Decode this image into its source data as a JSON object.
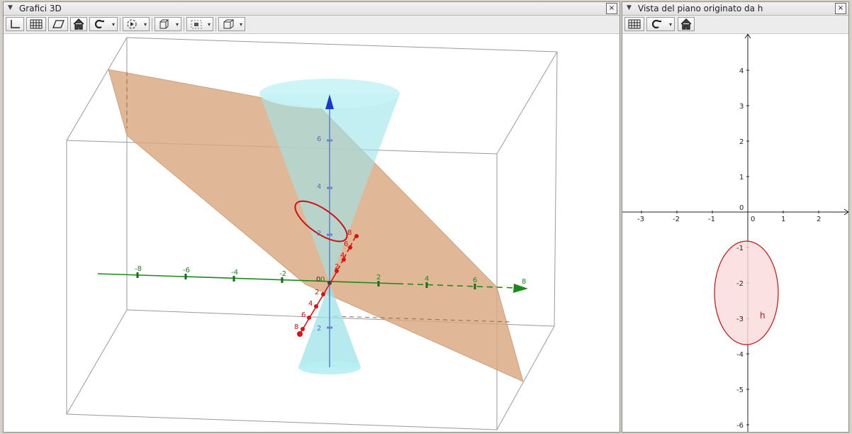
{
  "left_panel": {
    "title": "Grafici 3D",
    "close_glyph": "×",
    "toolbar": [
      "axes-icon",
      "grid-icon",
      "plane-icon",
      "home-icon",
      "rotate-view-icon",
      "animate-icon",
      "view-direction-icon",
      "projection-icon",
      "box-icon"
    ],
    "dropdown_caret": "▾",
    "x_axis_labels": [
      "-8",
      "-6",
      "-4",
      "-2",
      "0",
      "2",
      "4",
      "6",
      "8"
    ],
    "y_axis_labels": [
      "8",
      "6",
      "4",
      "2",
      "2",
      "4",
      "6",
      "8"
    ],
    "z_axis_labels": [
      "6",
      "4",
      "2",
      "2"
    ],
    "origin_label": "0"
  },
  "right_panel": {
    "title": "Vista del piano originato da h",
    "close_glyph": "×",
    "toolbar": [
      "grid-icon",
      "rotate-icon",
      "home-icon"
    ],
    "x_ticks": [
      "-3",
      "-2",
      "-1",
      "0",
      "1",
      "2"
    ],
    "y_ticks": [
      "4",
      "3",
      "2",
      "1",
      "0",
      "-1",
      "-2",
      "-3",
      "-4",
      "-5",
      "-6"
    ],
    "conic_label": "h"
  },
  "colors": {
    "plane": "#d9a880",
    "cone": "#9ee3ea",
    "x_axis": "#1a8a1a",
    "y_axis": "#dd1111",
    "z_axis": "#1a3acc",
    "conic": "#cc1111",
    "ellipse_fill": "#fbd9dc"
  }
}
